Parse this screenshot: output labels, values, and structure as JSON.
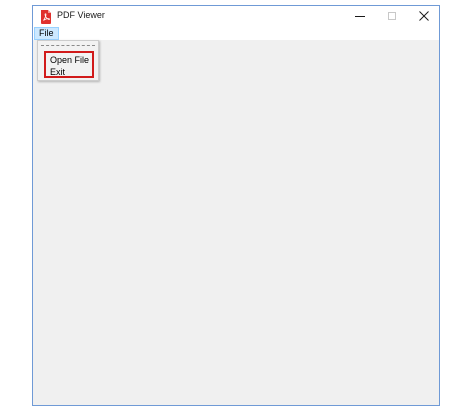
{
  "window": {
    "title": "PDF Viewer",
    "icon": "pdf-document-icon",
    "accent_color": "#d11a1a",
    "controls": {
      "minimize": "minimize-icon",
      "maximize": "maximize-icon",
      "close": "close-icon"
    }
  },
  "menubar": {
    "items": [
      {
        "label": "File",
        "active": true
      }
    ]
  },
  "file_menu": {
    "items": [
      {
        "label": "Open File"
      },
      {
        "label": "Exit"
      }
    ]
  }
}
